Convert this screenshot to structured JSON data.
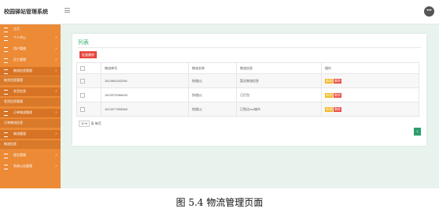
{
  "header": {
    "app_title": "校园驿站管理系统",
    "avatar_label": "•••"
  },
  "sidebar": {
    "items": [
      {
        "label": "主页",
        "arrow": ""
      },
      {
        "label": "个人中心",
        "arrow": "›"
      },
      {
        "label": "用户管理",
        "arrow": "›"
      },
      {
        "label": "员工管理",
        "arrow": "›"
      },
      {
        "label": "物流信息管理",
        "arrow": "›"
      },
      {
        "label": "取货信息管理",
        "arrow": ""
      },
      {
        "label": "发货信息",
        "arrow": "›"
      },
      {
        "label": "发货信息管理",
        "arrow": ""
      },
      {
        "label": "订单物流管理",
        "arrow": "›"
      },
      {
        "label": "订单物流信息",
        "arrow": ""
      },
      {
        "label": "物流管理",
        "arrow": "›"
      },
      {
        "label": "物流信息",
        "arrow": ""
      },
      {
        "label": "留言管理",
        "arrow": "›"
      },
      {
        "label": "系统公告管理",
        "arrow": "›"
      }
    ]
  },
  "main": {
    "card_title": "列表",
    "batch_delete_label": "批量删除",
    "table": {
      "headers": [
        "",
        "物流单号",
        "物流名称",
        "物流信息",
        "操作"
      ],
      "rows": [
        {
          "tracking_no": "1613981182236",
          "name": "快递[2]",
          "info": "暂无物流信息"
        },
        {
          "tracking_no": "1613975266649",
          "name": "快递[2]",
          "info": "已打包"
        },
        {
          "tracking_no": "1613977995565",
          "name": "快递[1]",
          "info": "已到达xxx城市"
        }
      ],
      "edit_label": "修改",
      "delete_label": "删除"
    },
    "page_size_value": "10",
    "page_size_suffix": "条 每页",
    "current_page": "1"
  },
  "caption": "图 5.4  物流管理页面",
  "colors": {
    "sidebar": "#ed8a35",
    "accent_green": "#3bb273",
    "danger": "#e8453c",
    "warning": "#f3b51e"
  }
}
